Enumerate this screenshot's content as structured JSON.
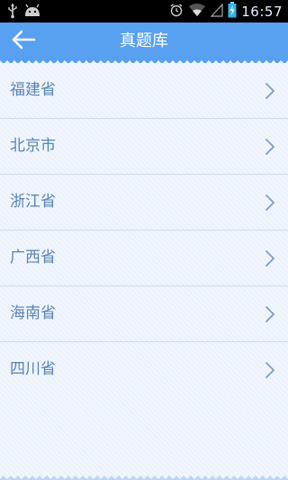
{
  "status_bar": {
    "time": "16:57",
    "icons": [
      "usb-icon",
      "android-icon",
      "alarm-icon",
      "wifi-icon",
      "signal-icon",
      "battery-charging-icon"
    ]
  },
  "header": {
    "title": "真题库",
    "back_icon": "arrow-left-icon",
    "background_color": "#58a0f0"
  },
  "list": {
    "items": [
      {
        "label": "福建省"
      },
      {
        "label": "北京市"
      },
      {
        "label": "浙江省"
      },
      {
        "label": "广西省"
      },
      {
        "label": "海南省"
      },
      {
        "label": "四川省"
      }
    ],
    "text_color": "#5a84b4",
    "chevron_icon": "chevron-right-icon"
  }
}
